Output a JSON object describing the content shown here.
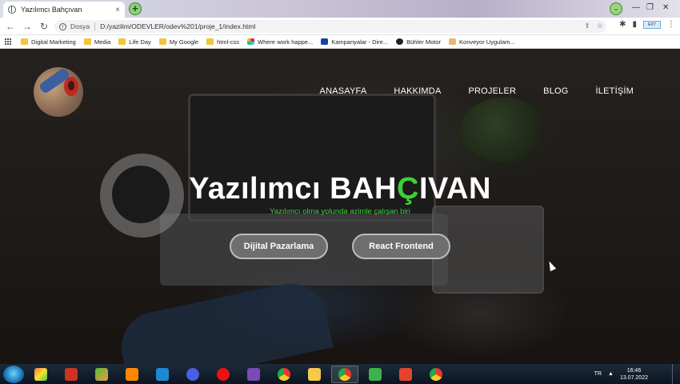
{
  "browser": {
    "tab_title": "Yazılımcı Bahçıvan",
    "tab_close": "×",
    "new_tab": "+",
    "url_scheme_label": "Dosya",
    "url": "D:/yazilim/ODEVLER/odev%201/proje_1/index.html",
    "nav": {
      "back": "←",
      "forward": "→",
      "reload": "C"
    },
    "window_controls": {
      "minimize": "—",
      "restore": "❐",
      "close": "✕"
    },
    "bookmarks": [
      {
        "label": "Digital Marketing",
        "icon": "folder-icon"
      },
      {
        "label": "Media",
        "icon": "folder-icon"
      },
      {
        "label": "Life Day",
        "icon": "folder-icon"
      },
      {
        "label": "My Google",
        "icon": "folder-icon"
      },
      {
        "label": "html-css",
        "icon": "folder-icon"
      },
      {
        "label": "Where work happe...",
        "icon": "slack-icon"
      },
      {
        "label": "Kampanyalar - Dire...",
        "icon": "site-icon"
      },
      {
        "label": "Bühler Motor",
        "icon": "globe-icon"
      },
      {
        "label": "Konveyor Uygulam...",
        "icon": "site-icon"
      }
    ]
  },
  "site": {
    "nav": [
      "ANASAYFA",
      "HAKKIMDA",
      "PROJELER",
      "BLOG",
      "İLETİŞİM"
    ],
    "hero_title_main": "Yazılımcı BAH",
    "hero_title_accent": "Ç",
    "hero_title_end": "IVAN",
    "hero_subtitle": "Yazılımcı olma yolunda azimle çalışan biri",
    "buttons": [
      "Dijital Pazarlama",
      "React Frontend"
    ],
    "accent_color": "#3fcf3a"
  },
  "taskbar": {
    "language": "TR",
    "time": "16:46",
    "date": "13.07.2022"
  }
}
